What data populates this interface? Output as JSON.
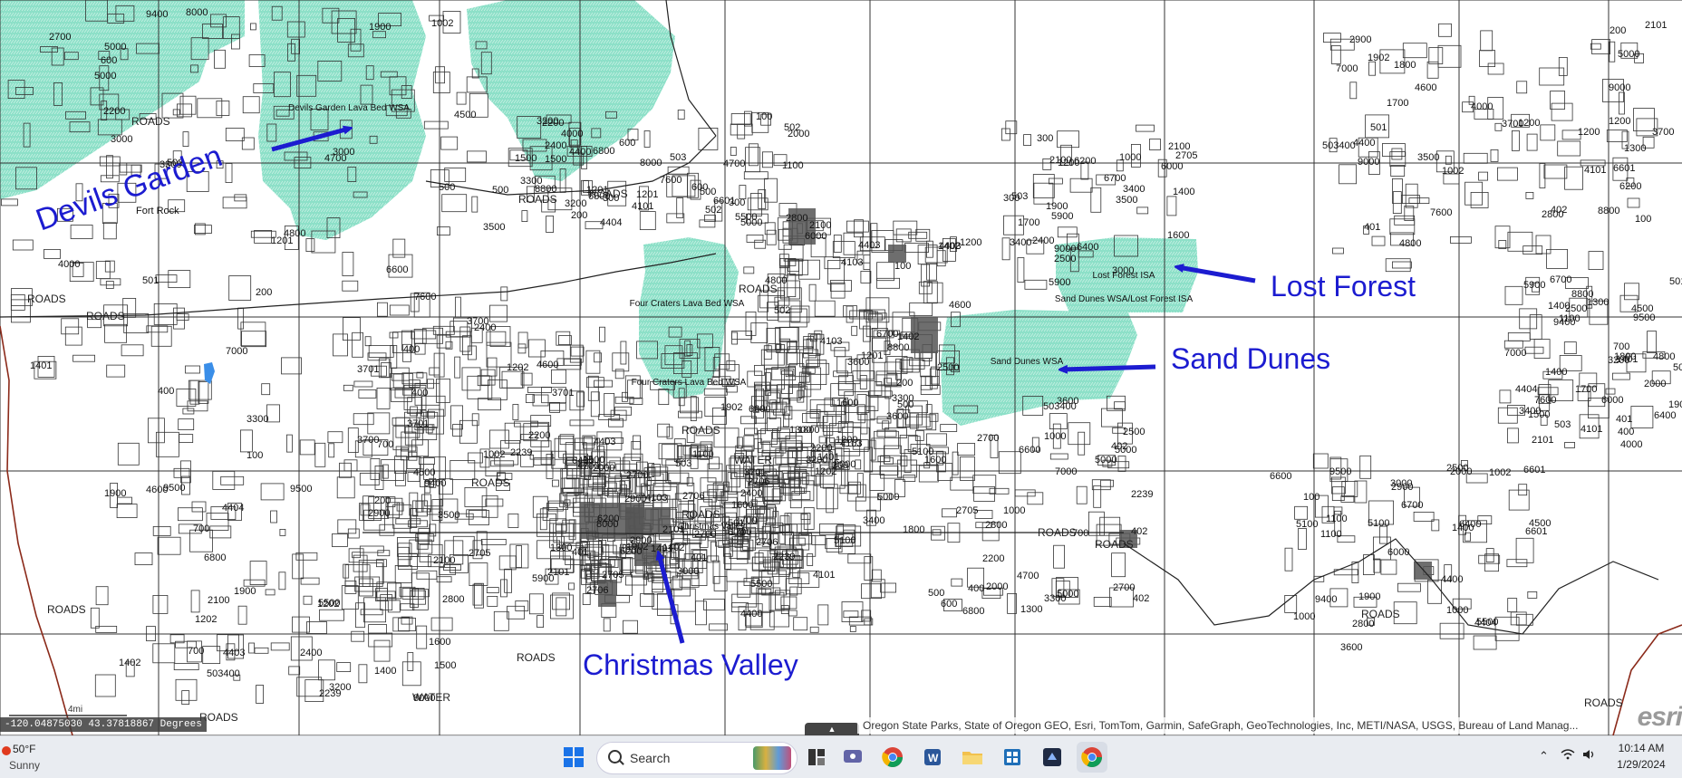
{
  "map": {
    "road_labels": [
      "ROADS",
      "ROADS",
      "ROADS",
      "ROADS",
      "ROADS",
      "ROADS",
      "ROADS",
      "ROADS",
      "ROADS",
      "ROADS",
      "ROADS",
      "ROADS",
      "ROADS",
      "ROADS",
      "ROADS",
      "ROADS"
    ],
    "water_labels": [
      "WATER",
      "WATER"
    ],
    "place_labels": [
      "Fort Rock",
      "Christmas Valley"
    ],
    "wsa_labels": [
      "Devils Garden Lava Bed WSA",
      "Four Craters Lava Bed WSA",
      "Four Craters Lava Bed WSA",
      "Lost Forest ISA",
      "Sand Dunes WSA/Lost Forest ISA",
      "Sand Dunes WSA"
    ],
    "annotations": [
      "Devils Garden",
      "Lost Forest",
      "Sand Dunes",
      "Christmas Valley"
    ],
    "parcel_numbers": [
      "200",
      "300",
      "100",
      "400",
      "600",
      "700",
      "500",
      "1000",
      "1100",
      "1200",
      "1300",
      "1400",
      "1500",
      "1600",
      "1700",
      "1800",
      "1900",
      "2000",
      "2100",
      "2200",
      "2400",
      "2500",
      "2700",
      "2800",
      "2900",
      "3000",
      "3200",
      "3300",
      "3400",
      "3500",
      "3600",
      "3700",
      "4000",
      "4400",
      "4500",
      "4600",
      "4700",
      "4800",
      "5000",
      "5100",
      "5500",
      "5900",
      "6000",
      "6200",
      "6400",
      "6600",
      "6700",
      "6800",
      "7000",
      "7600",
      "8000",
      "8800",
      "9000",
      "9400",
      "9500",
      "401",
      "402",
      "503",
      "502",
      "501",
      "3701",
      "4101",
      "4103",
      "2705",
      "2706",
      "1902",
      "4403",
      "4404",
      "6601",
      "5000",
      "503400",
      "2239",
      "1401",
      "1402",
      "2101",
      "1201",
      "1002",
      "1202"
    ],
    "attribution": "Oregon State Parks, State of Oregon GEO, Esri, TomTom, Garmin, SafeGraph, GeoTechnologies, Inc, METI/NASA, USGS, Bureau of Land Manag...",
    "coordinate_readout": "-120.04875030 43.37818867 Degrees",
    "scale_label": "4mi",
    "logo": "esri",
    "colors": {
      "wsa_fill": "#8de0c8",
      "wsa_hatch": "#ffffff",
      "parcel_line": "#333333",
      "annotation": "#1c1cd0",
      "blue_spot": "#3a8ee8"
    }
  },
  "taskbar": {
    "weather_temp": "50°F",
    "weather_condition": "Sunny",
    "search_placeholder": "Search",
    "apps": [
      "start-icon",
      "search-icon",
      "widgets-icon",
      "task-view-icon",
      "teams-icon",
      "chrome-icon",
      "word-icon",
      "file-explorer-icon",
      "calculator-icon",
      "app-icon",
      "chrome-active-icon"
    ],
    "tray_icons": [
      "chevron-up-icon",
      "wifi-icon",
      "volume-icon"
    ],
    "time": "10:14 AM",
    "date": "1/29/2024"
  }
}
